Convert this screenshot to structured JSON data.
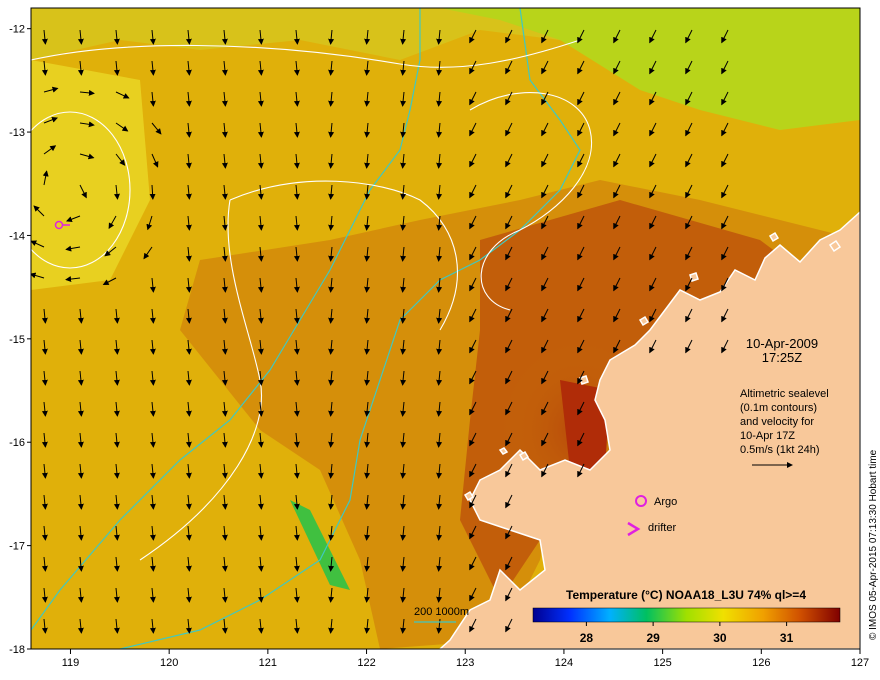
{
  "map": {
    "axes": {
      "x_ticks": [
        "119",
        "120",
        "121",
        "122",
        "123",
        "124",
        "125",
        "126",
        "127"
      ],
      "y_ticks": [
        "-12",
        "-13",
        "-14",
        "-15",
        "-16",
        "-17",
        "-18"
      ],
      "xlim": [
        118.6,
        127.0
      ],
      "ylim": [
        -18.0,
        -11.8
      ]
    },
    "date_line": "10-Apr-2009",
    "time_line": "17:25Z",
    "info_lines": [
      "Altimetric sealevel",
      "(0.1m contours)",
      "and velocity for",
      "10-Apr 17Z",
      "0.5m/s (1kt 24h)"
    ],
    "legend": {
      "argo_label": "Argo",
      "drifter_label": "drifter",
      "bathy_label": "200  1000m"
    },
    "colorbar": {
      "title": "Temperature (°C) NOAA18_L3U 74% ql>=4",
      "ticks": [
        "28",
        "29",
        "30",
        "31"
      ],
      "range": [
        27.2,
        31.8
      ]
    },
    "credit": "© IMOS 05-Apr-2015 07:13:30 Hobart time",
    "colors": {
      "ocean_warm": "#e0b00a",
      "ocean_hot": "#c66a0a",
      "ocean_cool": "#b8d41a",
      "land": "#f8c89a",
      "coast": "#ffffff",
      "bathymetry": "#40c8c0",
      "sealevel_contour": "#ffffff",
      "marker": "#e020e0"
    }
  }
}
